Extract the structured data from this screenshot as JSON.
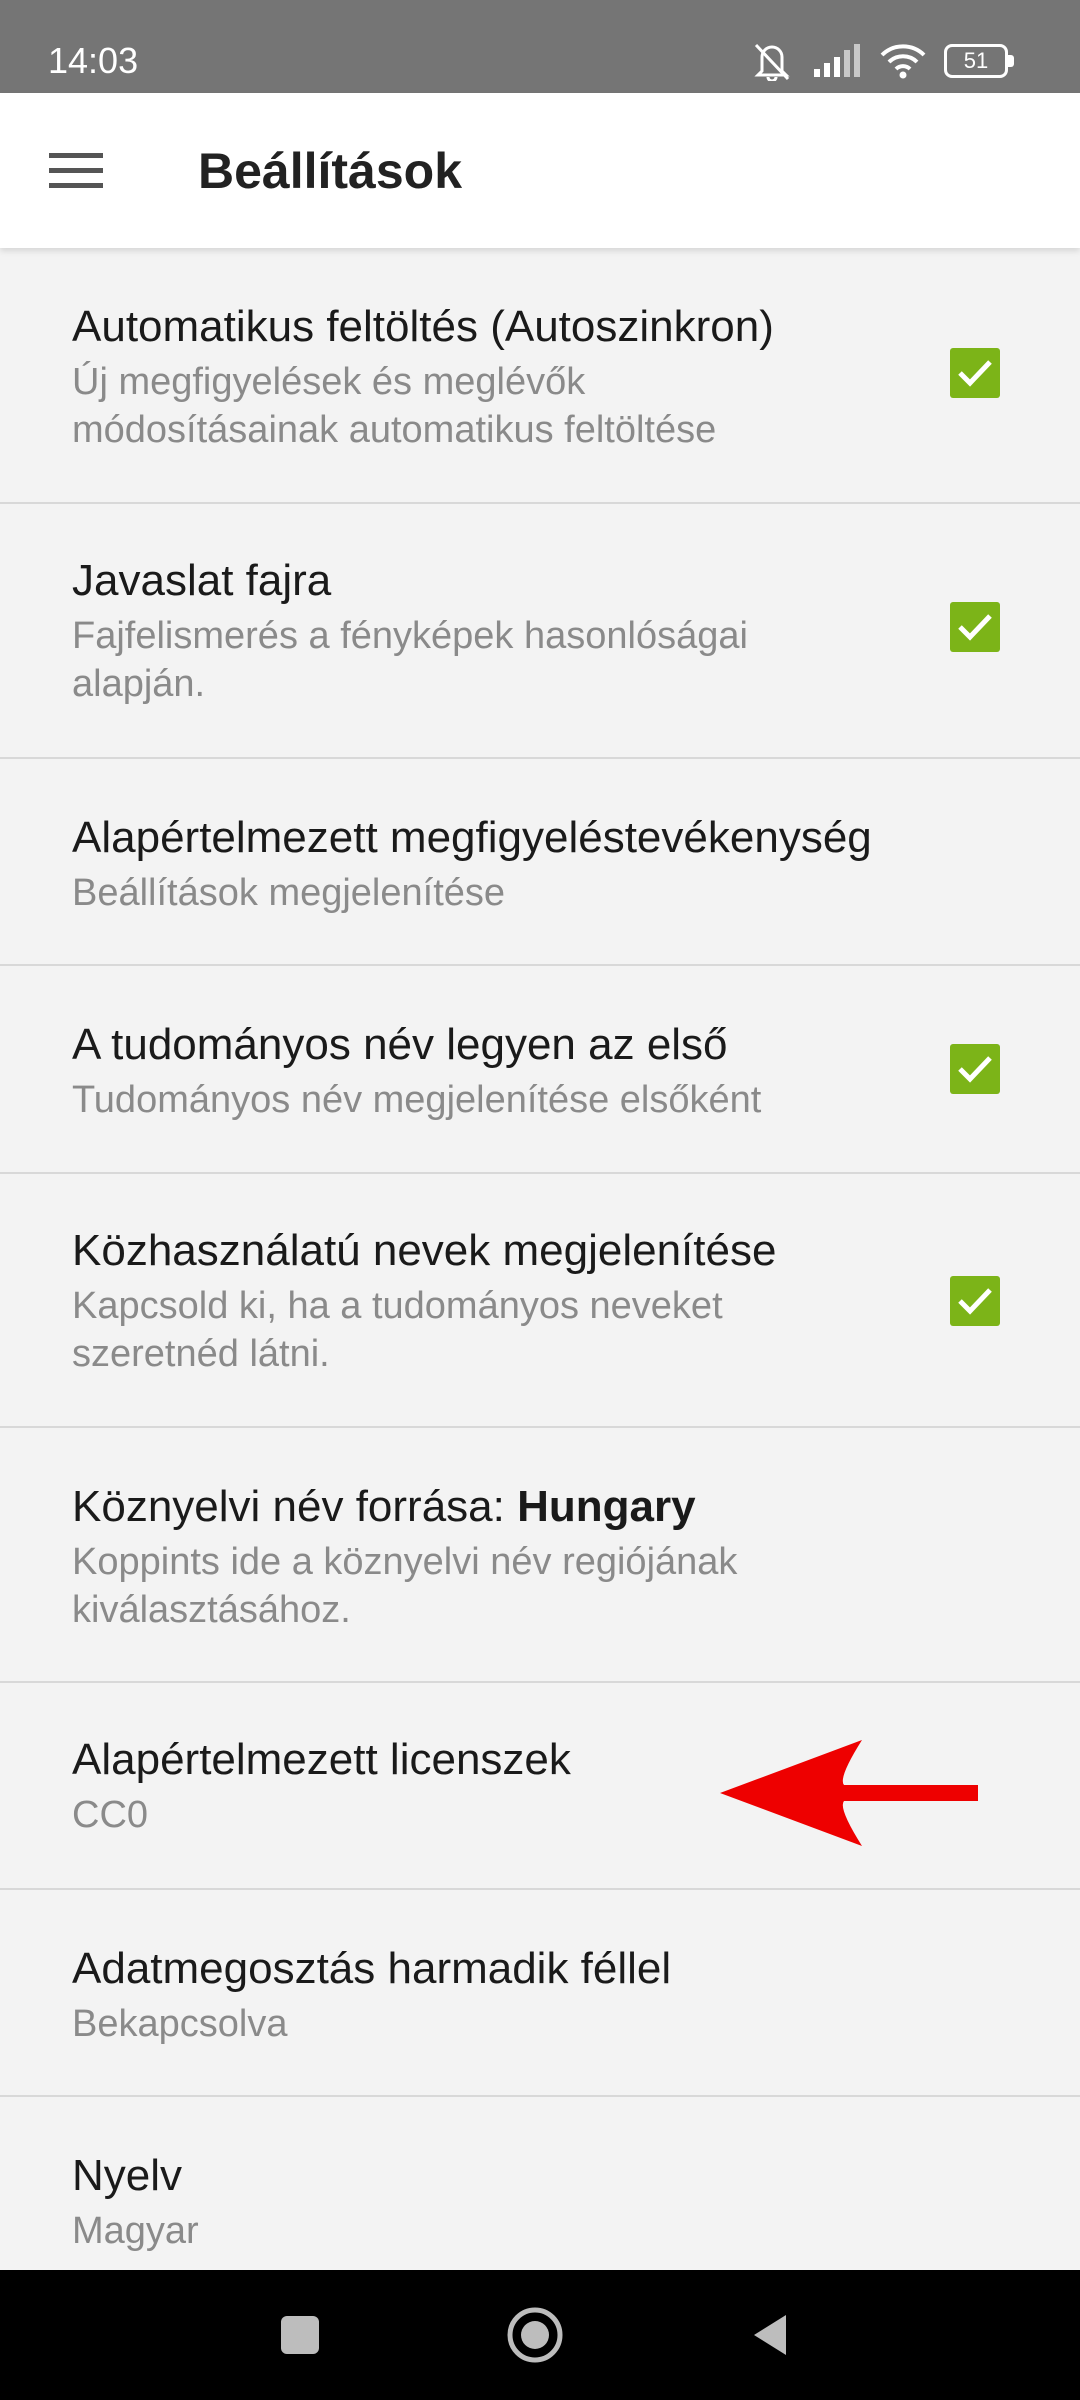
{
  "status_bar": {
    "time": "14:03",
    "battery": "51",
    "icons": [
      "mute-icon",
      "signal-icon",
      "wifi-icon",
      "battery-icon"
    ]
  },
  "toolbar": {
    "menu_icon": "hamburger-menu-icon",
    "title": "Beállítások"
  },
  "settings": [
    {
      "title": "Automatikus feltöltés (Autoszinkron)",
      "summary": "Új megfigyelések és meglévők módosításainak automatikus feltöltése",
      "checked": true
    },
    {
      "title": "Javaslat fajra",
      "summary": "Fajfelismerés a fényképek hasonlóságai alapján.",
      "checked": true
    },
    {
      "title": "Alapértelmezett megfigyeléstevékenység",
      "summary": "Beállítások megjelenítése"
    },
    {
      "title": "A tudományos név legyen az első",
      "summary": "Tudományos név megjelenítése elsőként",
      "checked": true
    },
    {
      "title": "Közhasználatú nevek megjelenítése",
      "summary": "Kapcsold ki, ha a tudományos neveket szeretnéd látni.",
      "checked": true
    },
    {
      "title_prefix": "Köznyelvi név forrása: ",
      "title_value": "Hungary",
      "summary": "Koppints ide a köznyelvi név regiójának kiválasztásához."
    },
    {
      "title": "Alapértelmezett licenszek",
      "summary": "CC0"
    },
    {
      "title": "Adatmegosztás harmadik féllel",
      "summary": "Bekapcsolva"
    },
    {
      "title": "Nyelv",
      "summary": "Magyar"
    }
  ],
  "colors": {
    "checkbox": "#7cb418",
    "annotation_arrow": "#ee0000",
    "status_bar": "#757575"
  },
  "nav_bar": {
    "icons": [
      "recents-icon",
      "home-icon",
      "back-icon"
    ]
  }
}
